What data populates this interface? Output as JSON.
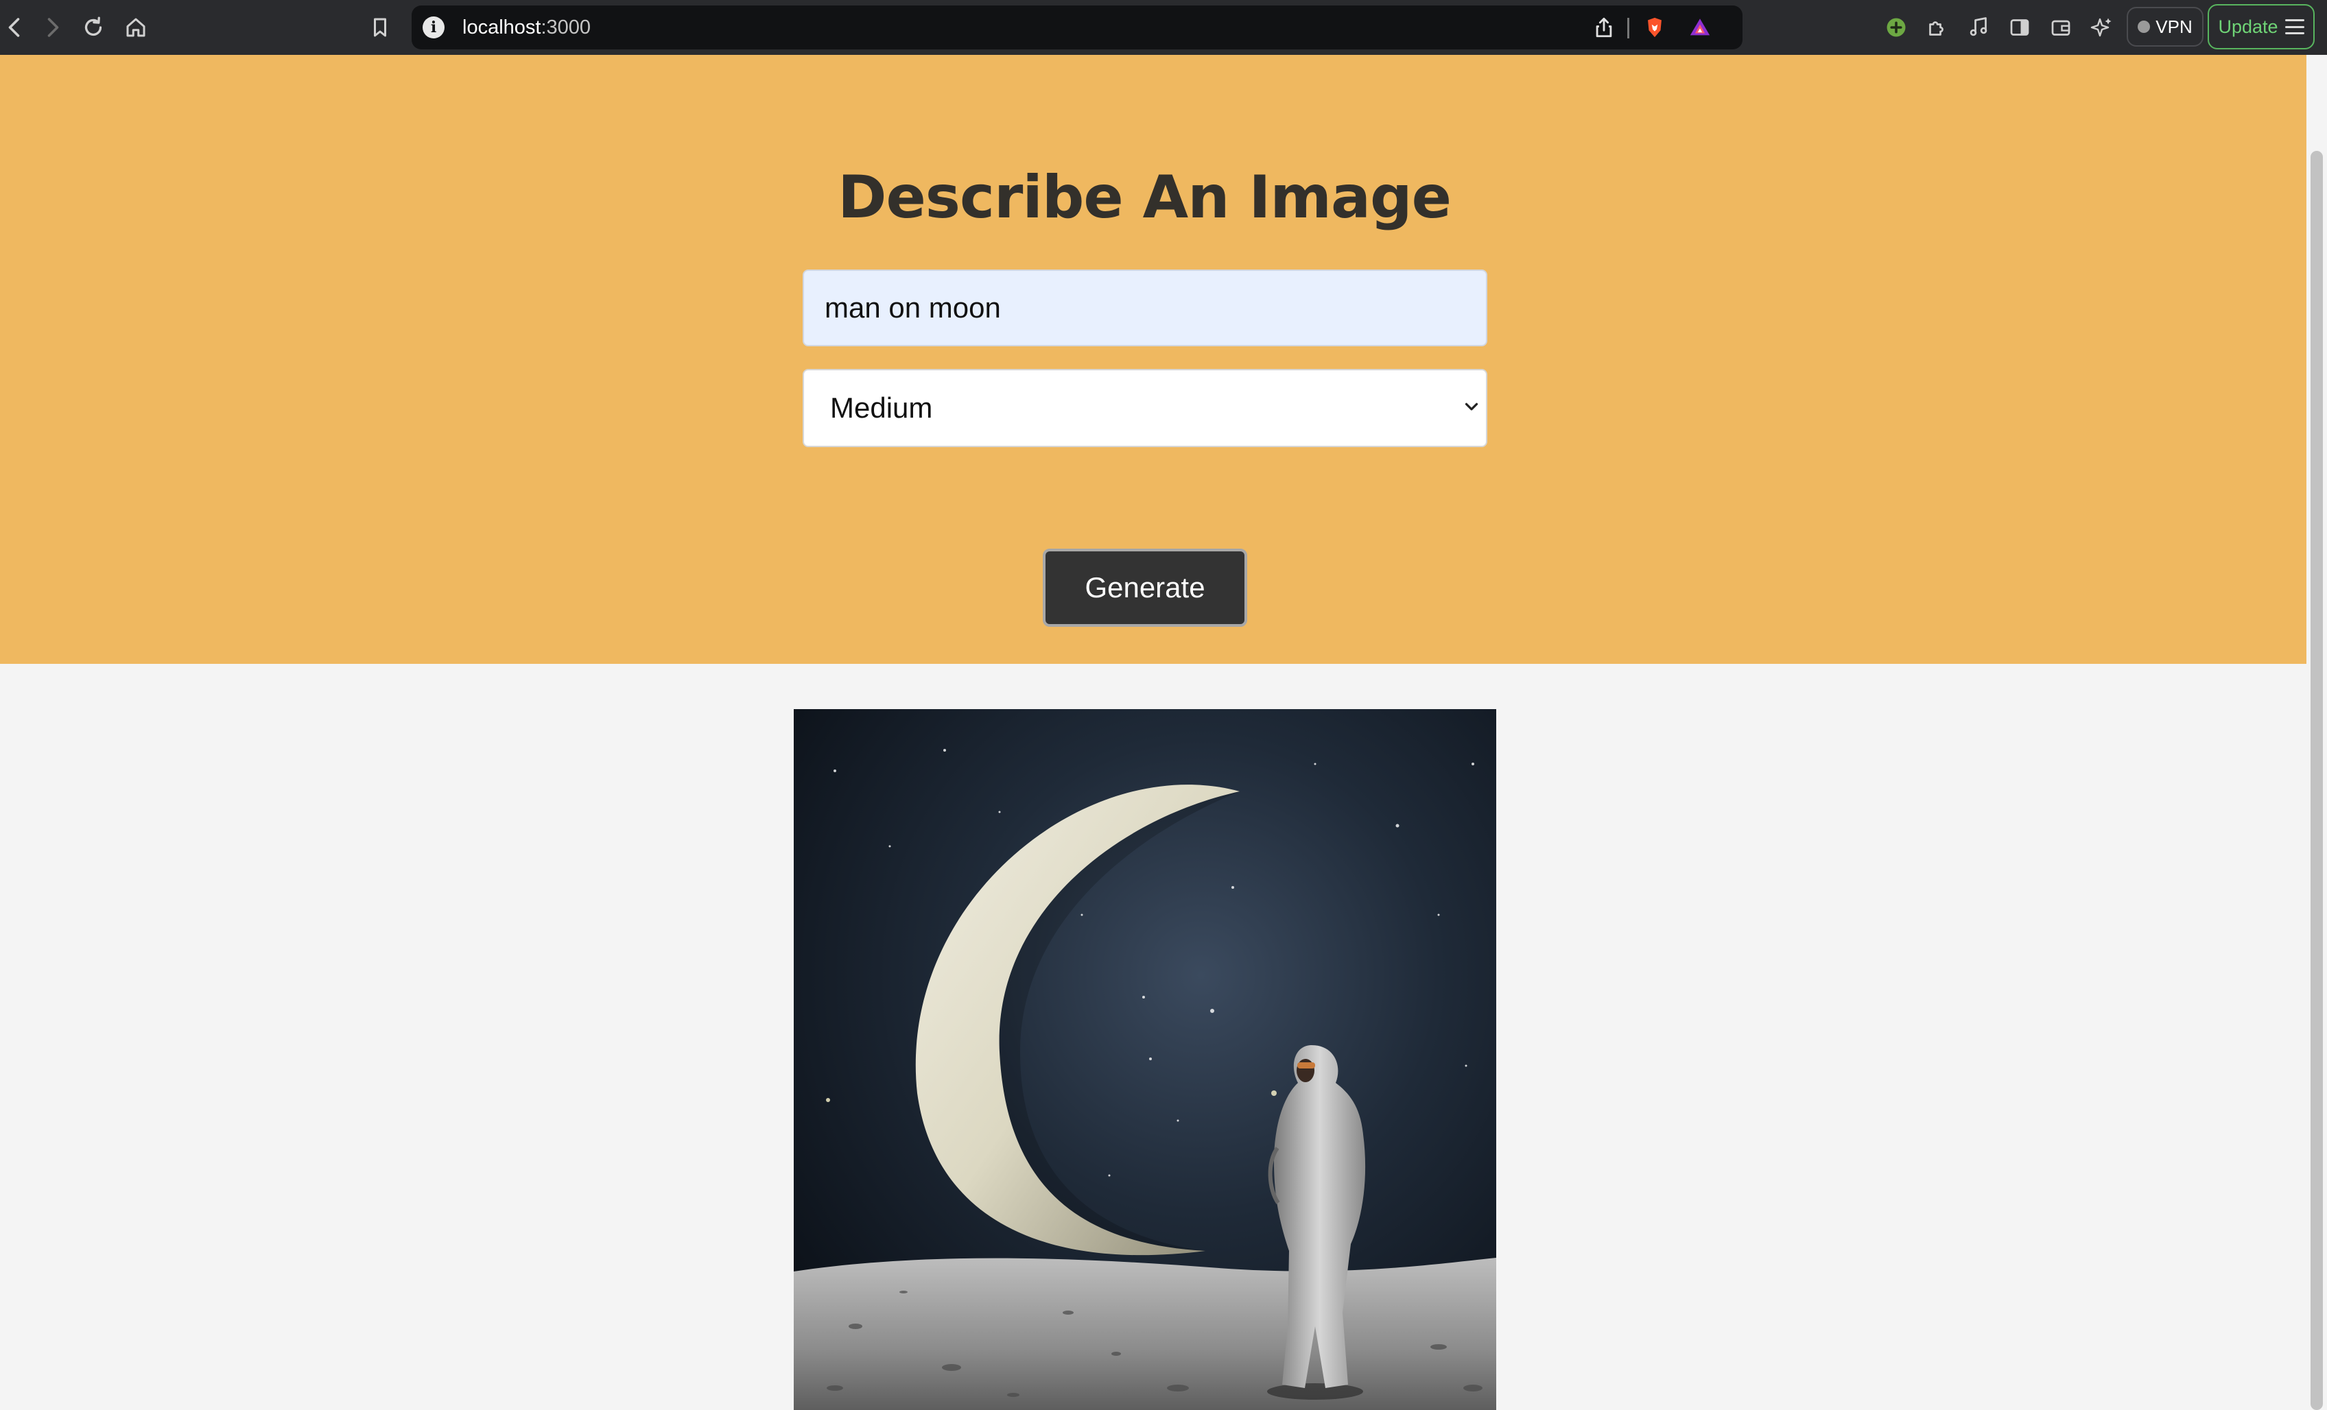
{
  "browser": {
    "url_host": "localhost",
    "url_port": ":3000",
    "vpn_label": "VPN",
    "update_label": "Update"
  },
  "page": {
    "title": "Describe An Image",
    "prompt_value": "man on moon",
    "size_selected": "Medium",
    "generate_label": "Generate"
  },
  "colors": {
    "hero_bg": "#efb860",
    "page_bg": "#f4f4f4",
    "button_bg": "#333333",
    "toolbar_bg": "#2a2b2e"
  }
}
